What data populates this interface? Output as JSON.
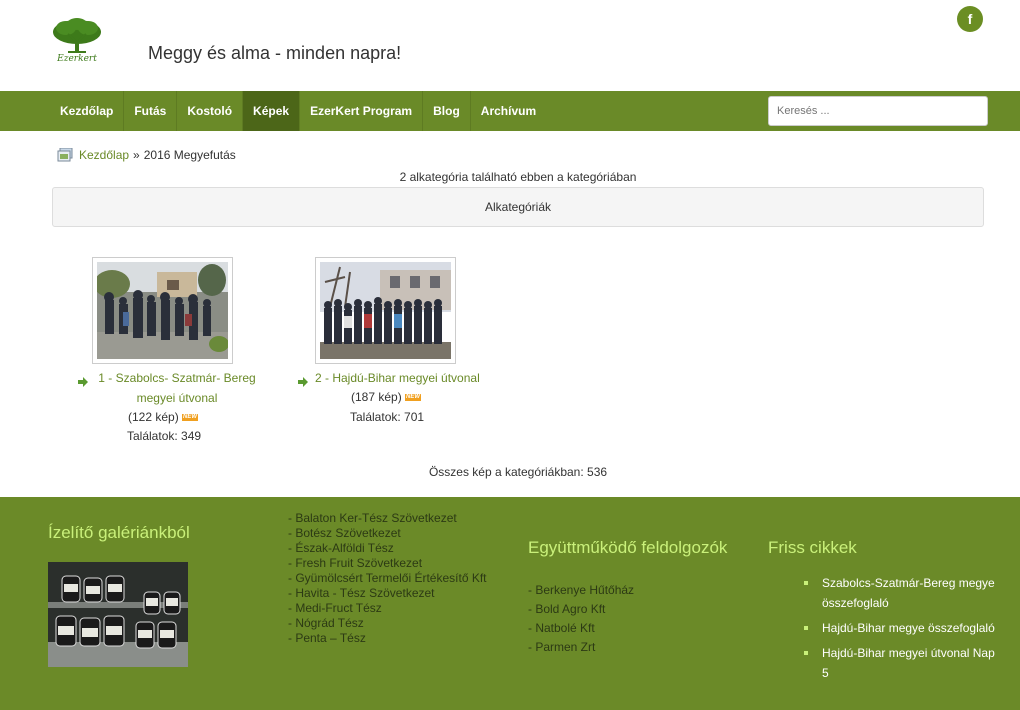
{
  "header": {
    "logo_text": "Ezerkert",
    "tagline": "Meggy és alma - minden napra!",
    "facebook_glyph": "f"
  },
  "nav": {
    "items": [
      {
        "label": "Kezdőlap"
      },
      {
        "label": "Futás"
      },
      {
        "label": "Kostoló"
      },
      {
        "label": "Képek"
      },
      {
        "label": "EzerKert Program"
      },
      {
        "label": "Blog"
      },
      {
        "label": "Archívum"
      }
    ],
    "active": "Képek",
    "search_placeholder": "Keresés ..."
  },
  "breadcrumb": {
    "home": "Kezdőlap",
    "separator": "»",
    "current": "2016 Megyefutás"
  },
  "subcategories": {
    "count_text": "2 alkategória található ebben a kategóriában",
    "box_label": "Alkategóriák"
  },
  "categories": [
    {
      "title": "1 - Szabolcs- Szatmár- Bereg megyei útvonal",
      "images": "(122 kép)",
      "new_badge": "NEW",
      "hits": "Találatok: 349"
    },
    {
      "title": "2 - Hajdú-Bihar megyei útvonal",
      "images": "(187 kép)",
      "new_badge": "NEW",
      "hits": "Találatok: 701"
    }
  ],
  "total_images": "Összes kép a kategóriákban: 536",
  "footer": {
    "gallery_title": "Ízelítő galériánkból",
    "partners": [
      "- Balaton Ker-Tész Szövetkezet",
      "- Botész Szövetkezet",
      "- Észak-Alföldi Tész",
      "- Fresh Fruit Szövetkezet",
      "- Gyümölcsért Termelői Értékesítő Kft",
      "- Havita - Tész Szövetkezet",
      "- Medi-Fruct Tész",
      "- Nógrád Tész",
      "- Penta – Tész"
    ],
    "processors_title": "Együttműködő feldolgozók",
    "processors": [
      "- Berkenye Hűtőház",
      "- Bold Agro Kft",
      "- Natbolé Kft",
      "- Parmen Zrt"
    ],
    "fresh_title": "Friss cikkek",
    "fresh": [
      "Szabolcs-Szatmár-Bereg megye összefoglaló",
      "Hajdú-Bihar megye összefoglaló",
      "Hajdú-Bihar megyei útvonal Nap 5"
    ]
  },
  "colors": {
    "brand_green": "#6a8a28",
    "active_nav": "#4c6618",
    "footer_heading": "#c9f07a"
  }
}
